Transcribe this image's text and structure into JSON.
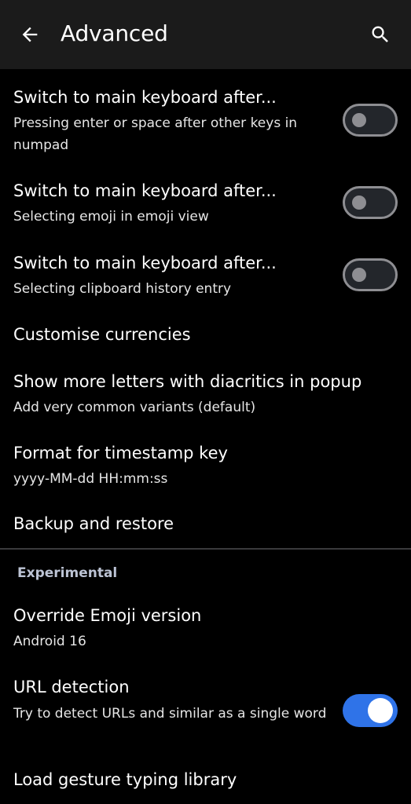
{
  "app_bar": {
    "title": "Advanced",
    "back_icon": "arrow-back-icon",
    "search_icon": "search-icon",
    "background": "#1b1b1b"
  },
  "settings": [
    {
      "title": "Switch to main keyboard after...",
      "subtitle": "Pressing enter or space after other keys in numpad",
      "toggle": false
    },
    {
      "title": "Switch to main keyboard after...",
      "subtitle": "Selecting emoji in emoji view",
      "toggle": false
    },
    {
      "title": "Switch to main keyboard after...",
      "subtitle": "Selecting clipboard history entry",
      "toggle": false
    },
    {
      "title": "Customise currencies"
    },
    {
      "title": "Show more letters with diacritics in popup",
      "subtitle": "Add very common variants (default)"
    },
    {
      "title": "Format for timestamp key",
      "subtitle": "yyyy-MM-dd HH:mm:ss"
    },
    {
      "title": "Backup and restore"
    }
  ],
  "experimental": {
    "header": "Experimental",
    "items": [
      {
        "title": "Override Emoji version",
        "subtitle": "Android 16"
      },
      {
        "title": "URL detection",
        "subtitle": "Try to detect URLs and similar as a single word",
        "toggle": true
      },
      {
        "title": "Load gesture typing library"
      }
    ]
  },
  "colors": {
    "background": "#000000",
    "accent": "#2f73e8",
    "switch_off_track": "#23262b",
    "switch_off_outline": "#8e8e92",
    "section_header": "#bcc3d4"
  }
}
